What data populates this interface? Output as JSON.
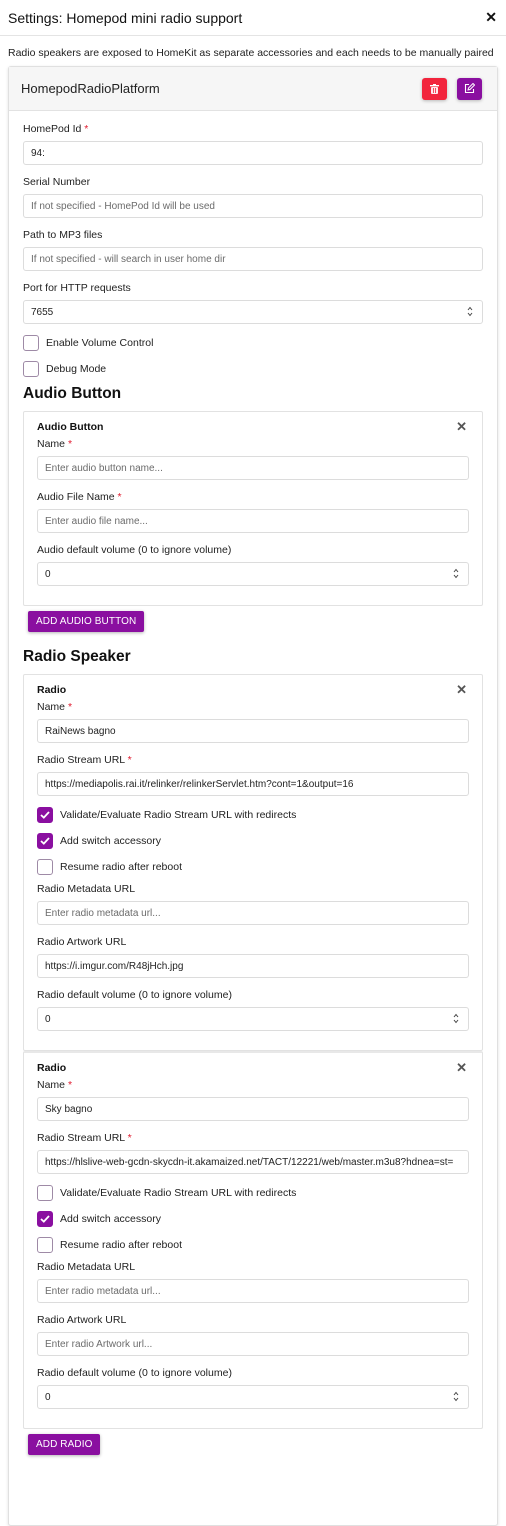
{
  "modal": {
    "title": "Settings: Homepod mini radio support",
    "close_icon": "close-icon",
    "description": "Radio speakers are exposed to HomeKit as separate accessories and each needs to be manually paired"
  },
  "platform": {
    "title": "HomepodRadioPlatform",
    "delete_icon": "trash-icon",
    "edit_icon": "edit-icon",
    "accent_delete": "#f2243c",
    "accent_primary": "#8a0fa0",
    "fields": {
      "homepod_id": {
        "label": "HomePod Id",
        "required": "*",
        "value": "94:"
      },
      "serial_number": {
        "label": "Serial Number",
        "value": "",
        "placeholder": "If not specified - HomePod Id will be used"
      },
      "mp3_path": {
        "label": "Path to MP3 files",
        "value": "",
        "placeholder": "If not specified - will search in user home dir"
      },
      "http_port": {
        "label": "Port for HTTP requests",
        "value": "7655"
      }
    },
    "checkboxes": {
      "volume_control": {
        "label": "Enable Volume Control",
        "checked": false
      },
      "debug_mode": {
        "label": "Debug Mode",
        "checked": false
      }
    }
  },
  "audio_section": {
    "title": "Audio Button",
    "items": [
      {
        "title": "Audio Button",
        "name_label": "Name",
        "name_value": "",
        "name_placeholder": "Enter audio button name...",
        "file_label": "Audio File Name",
        "file_value": "",
        "file_placeholder": "Enter audio file name...",
        "volume_label": "Audio default volume (0 to ignore volume)",
        "volume_value": "0"
      }
    ],
    "add_label": "ADD AUDIO BUTTON"
  },
  "radio_section": {
    "title": "Radio Speaker",
    "required_mark": "*",
    "items": [
      {
        "title": "Radio",
        "name_label": "Name",
        "name_value": "RaiNews bagno",
        "url_label": "Radio Stream URL",
        "url_value": "https://mediapolis.rai.it/relinker/relinkerServlet.htm?cont=1&output=16",
        "validate_label": "Validate/Evaluate Radio Stream URL with redirects",
        "validate_checked": true,
        "switch_label": "Add switch accessory",
        "switch_checked": true,
        "resume_label": "Resume radio after reboot",
        "resume_checked": false,
        "metadata_label": "Radio Metadata URL",
        "metadata_value": "",
        "metadata_placeholder": "Enter radio metadata url...",
        "artwork_label": "Radio Artwork URL",
        "artwork_value": "https://i.imgur.com/R48jHch.jpg",
        "artwork_placeholder": "Enter radio Artwork url...",
        "volume_label": "Radio default volume (0 to ignore volume)",
        "volume_value": "0"
      },
      {
        "title": "Radio",
        "name_label": "Name",
        "name_value": "Sky bagno",
        "url_label": "Radio Stream URL",
        "url_value": "https://hlslive-web-gcdn-skycdn-it.akamaized.net/TACT/12221/web/master.m3u8?hdnea=st=",
        "validate_label": "Validate/Evaluate Radio Stream URL with redirects",
        "validate_checked": false,
        "switch_label": "Add switch accessory",
        "switch_checked": true,
        "resume_label": "Resume radio after reboot",
        "resume_checked": false,
        "metadata_label": "Radio Metadata URL",
        "metadata_value": "",
        "metadata_placeholder": "Enter radio metadata url...",
        "artwork_label": "Radio Artwork URL",
        "artwork_value": "",
        "artwork_placeholder": "Enter radio Artwork url...",
        "volume_label": "Radio default volume (0 to ignore volume)",
        "volume_value": "0"
      }
    ],
    "add_label": "ADD RADIO"
  }
}
